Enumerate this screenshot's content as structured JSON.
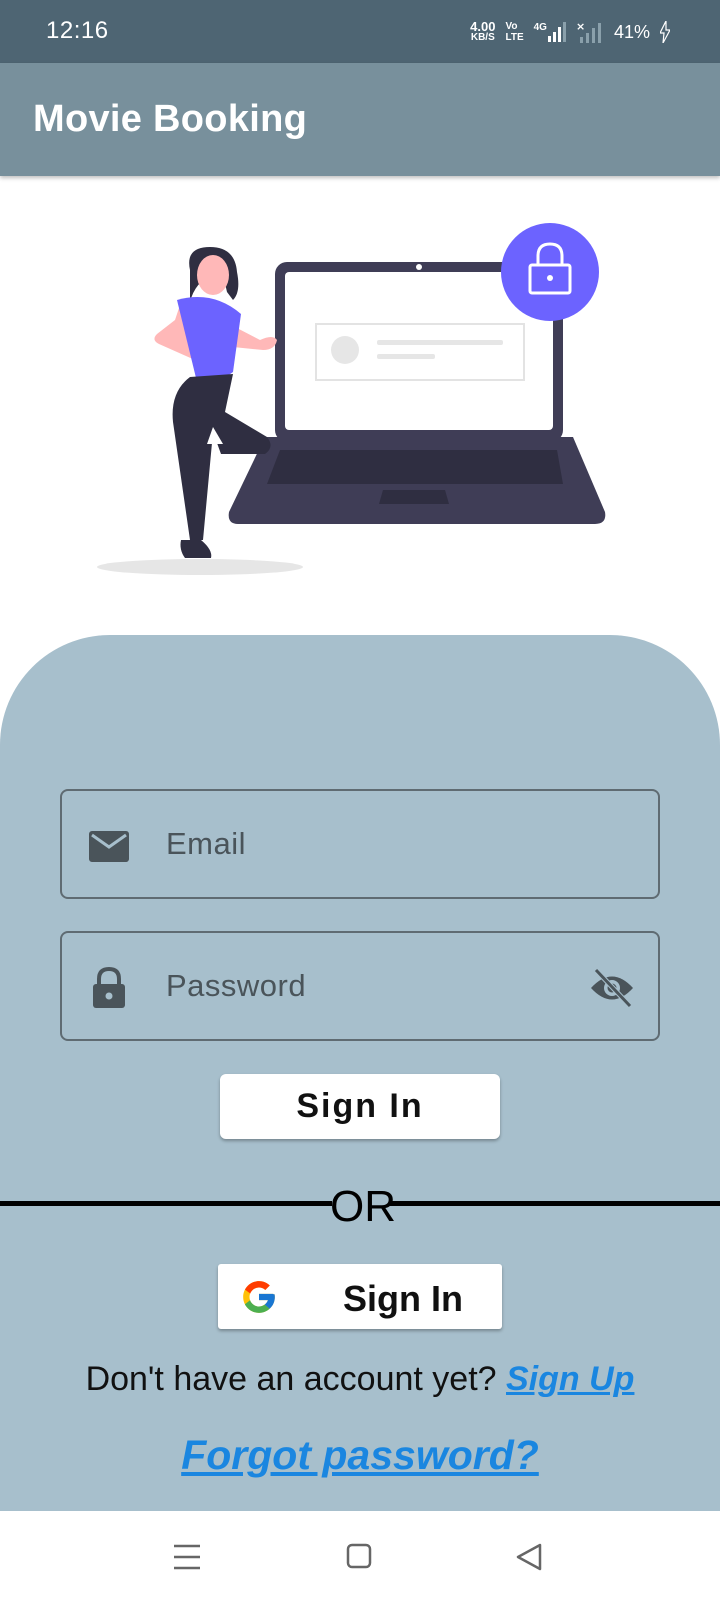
{
  "status_bar": {
    "time": "12:16",
    "net_speed_value": "4.00",
    "net_speed_unit": "KB/S",
    "volte_top": "Vo",
    "volte_bottom": "LTE",
    "network_type": "4G",
    "battery": "41%"
  },
  "app_bar": {
    "title": "Movie Booking"
  },
  "form": {
    "email_placeholder": "Email",
    "password_placeholder": "Password",
    "signin_label": "Sign In"
  },
  "divider": {
    "label": "OR"
  },
  "google": {
    "label": "Sign In"
  },
  "signup": {
    "prompt": "Don't have an account yet? ",
    "link": "Sign Up"
  },
  "forgot": {
    "label": "Forgot password?"
  },
  "colors": {
    "status_bar": "#4e6573",
    "app_bar": "#78909c",
    "panel": "#a7bfcc",
    "accent_purple": "#6c63ff",
    "link_blue": "#1a86e0"
  },
  "icons": {
    "email": "mail-icon",
    "password": "lock-icon",
    "visibility": "visibility-off-icon",
    "google": "google-logo-icon",
    "nav": [
      "menu-icon",
      "home-square-icon",
      "back-triangle-icon"
    ]
  }
}
